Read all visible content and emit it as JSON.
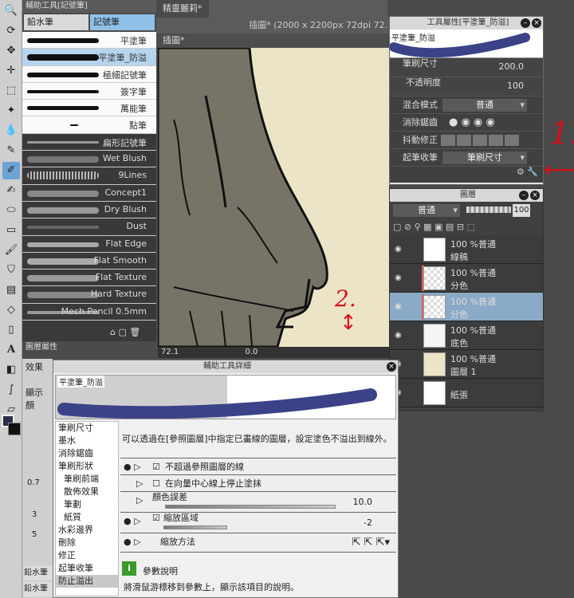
{
  "titlebar": {
    "canvas_tab": "精靈麗莉*",
    "canvas_title": "插圖* (2000 x 2200px 72dpi 72.",
    "subtab": "插圖*"
  },
  "subtool": {
    "title": "輔助工具[記號筆]",
    "tabs": [
      "鉛水筆",
      "記號筆"
    ],
    "brushes": [
      "平塗筆",
      "平塗筆_防溢",
      "極細記號筆",
      "簽字筆",
      "萬能筆",
      "點筆",
      "扁形記號筆",
      "Wet Blush",
      "9Lines",
      "Concept1",
      "Dry Blush",
      "Dust",
      "Flat Edge",
      "Flat Smooth",
      "Flat Texture",
      "Hard Texture",
      "Mech Pencil 0.5mm"
    ]
  },
  "canvas": {
    "zoom": "72.1",
    "angle": "0.0"
  },
  "toolprop": {
    "title": "工具屬性[平塗筆_防溢]",
    "preview_label": "平塗筆_防溢",
    "brush_size_label": "筆刷尺寸",
    "brush_size_value": "200.0",
    "opacity_label": "不透明度",
    "opacity_value": "100",
    "blend_label": "混合模式",
    "blend_value": "普通",
    "aa_label": "消除鋸齒",
    "stab_label": "抖動修正",
    "start_end_label": "起筆收筆",
    "start_end_value": "筆刷尺寸"
  },
  "layers": {
    "title": "圖層",
    "blend": "普通",
    "opacity": "100",
    "items": [
      {
        "mode": "100 %普通",
        "name": "線稿",
        "pattern": "plain"
      },
      {
        "mode": "100 %普通",
        "name": "分色",
        "pattern": "check"
      },
      {
        "mode": "100 %普通",
        "name": "分色",
        "pattern": "check"
      },
      {
        "mode": "100 %普通",
        "name": "底色",
        "pattern": "figure"
      },
      {
        "mode": "100 %普通",
        "name": "圖層 1",
        "pattern": "beige"
      },
      {
        "mode": "",
        "name": "紙張",
        "pattern": "paper"
      }
    ]
  },
  "layerprop": {
    "title": "圖層屬性",
    "effect": "效果",
    "display": "顯示顏"
  },
  "dialog": {
    "title": "輔助工具詳細",
    "preview_label": "平塗筆_防溢",
    "description": "可以透過在[參照圖層]中指定已畫線的圖層，設定塗色不溢出到線外。",
    "categories": [
      "筆刷尺寸",
      "墨水",
      "消除鋸齒",
      "筆刷形狀",
      "筆刷前端",
      "散佈效果",
      "筆劃",
      "紙質",
      "水彩邊界",
      "刪除",
      "修正",
      "起筆收筆",
      "防止溢出"
    ],
    "options": {
      "opt1": "不超過參照圖層的線",
      "opt2": "在向量中心線上停止塗抹",
      "opt3": "顏色誤差",
      "opt3_value": "10.0",
      "opt4": "縮放區域",
      "opt4_value": "-2",
      "opt5": "縮放方法"
    },
    "help_title": "參數說明",
    "help_text": "將滑鼠游標移到參數上，顯示該項目的說明。"
  },
  "annotations": {
    "mark1": "1.",
    "mark2": "2."
  },
  "toolcol": {
    "values": [
      "0.7",
      "3",
      "5"
    ],
    "bottom_tabs": [
      "鉛水筆",
      "鉛水筆"
    ]
  },
  "colors": {
    "accent": "#6ea3d6",
    "selection": "#b7d4ef",
    "annotation": "#d90f1c",
    "brush_preview": "#3b4287"
  }
}
